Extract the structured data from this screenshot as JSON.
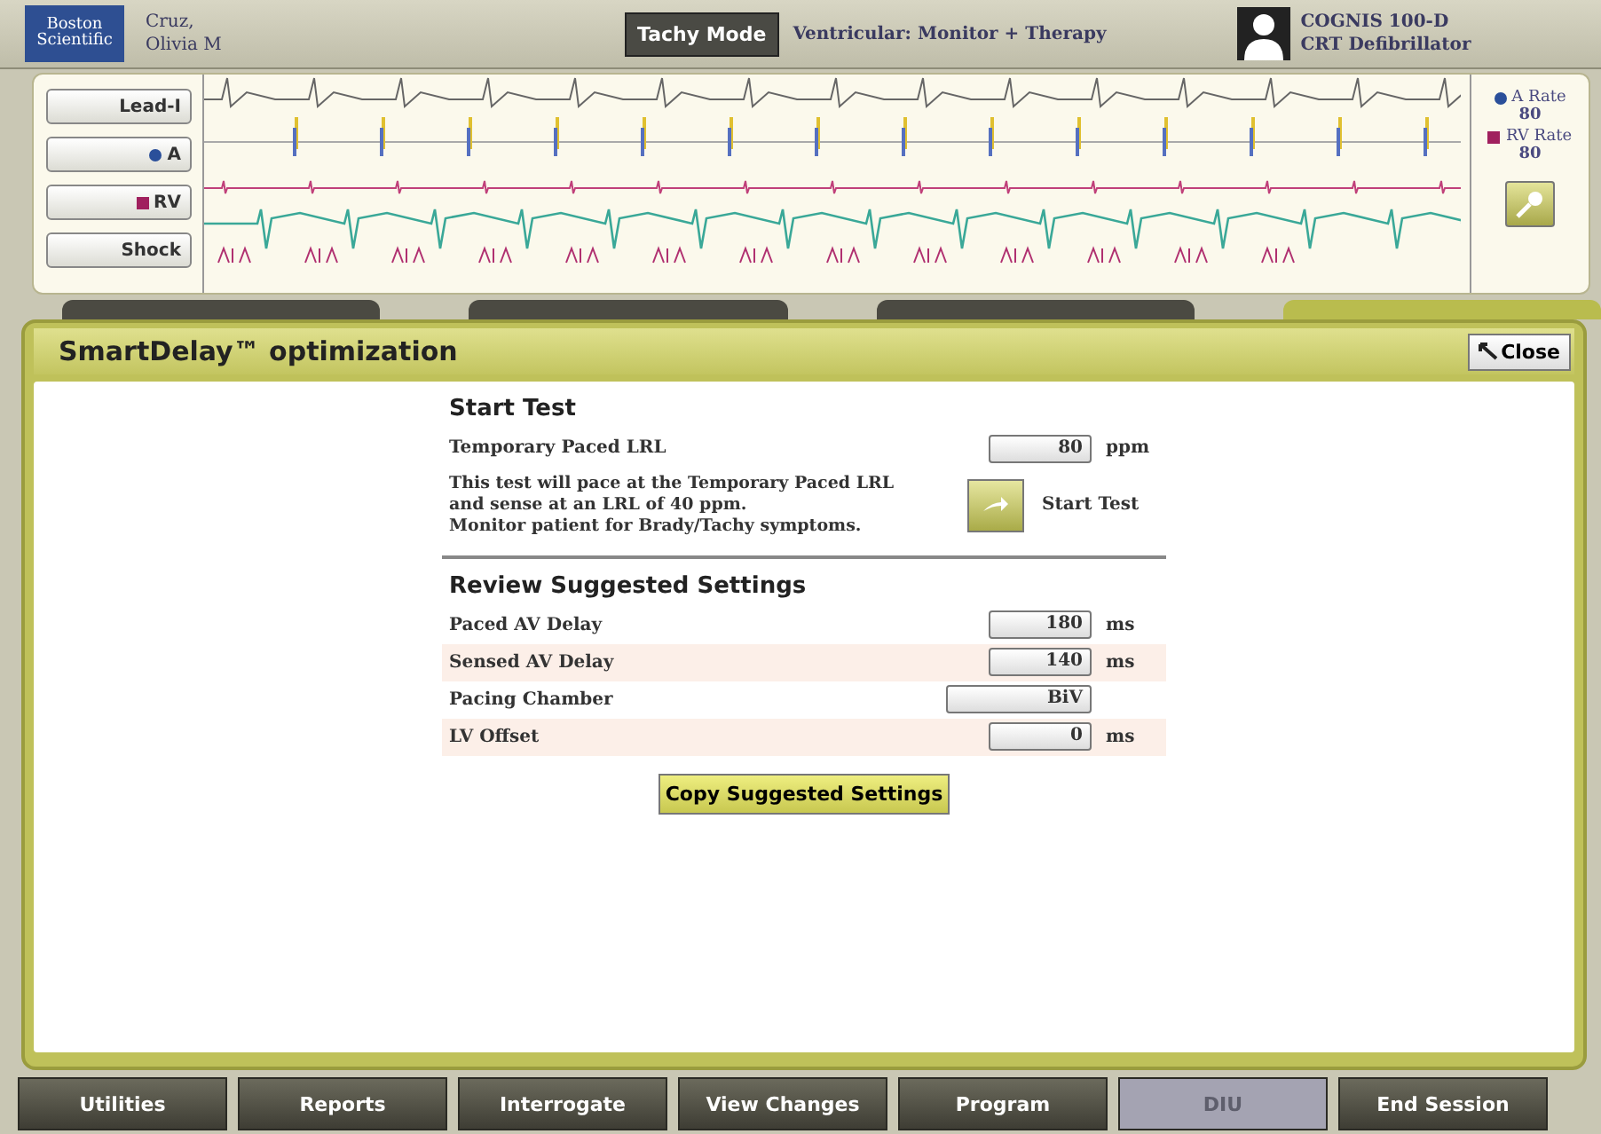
{
  "header": {
    "logo": "Boston Scientific",
    "patient": [
      "Cruz,",
      "Olivia M"
    ],
    "mode_button": "Tachy Mode",
    "mode_text": "Ventricular: Monitor + Therapy",
    "device": [
      "COGNIS 100-D",
      "CRT Defibrillator"
    ]
  },
  "ecg": {
    "channel_buttons": [
      {
        "label": "Lead-I"
      },
      {
        "label": "A",
        "kind": "dot",
        "color": "#2a4f9a"
      },
      {
        "label": "RV",
        "kind": "square",
        "color": "#a0205e"
      },
      {
        "label": "Shock"
      }
    ],
    "rates": [
      {
        "label": "A Rate",
        "value": "80",
        "kind": "dot",
        "color": "#2a4f9a"
      },
      {
        "label": "RV Rate",
        "value": "80",
        "kind": "square",
        "color": "#a0205e"
      }
    ]
  },
  "tabs": [
    {
      "selected": false
    },
    {
      "selected": false
    },
    {
      "selected": false
    },
    {
      "selected": true
    }
  ],
  "panel": {
    "title": "SmartDelay™ optimization",
    "close": "Close",
    "start_test": {
      "heading": "Start Test",
      "field_label": "Temporary Paced LRL",
      "value": "80",
      "unit": "ppm",
      "note": [
        "This test will pace at the Temporary Paced LRL",
        "and sense at an LRL of 40 ppm.",
        "Monitor patient for Brady/Tachy symptoms."
      ],
      "button": "Start Test"
    },
    "review": {
      "heading": "Review Suggested Settings",
      "rows": [
        {
          "label": "Paced AV Delay",
          "value": "180",
          "unit": "ms"
        },
        {
          "label": "Sensed AV Delay",
          "value": "140",
          "unit": "ms"
        },
        {
          "label": "Pacing Chamber",
          "value": "BiV"
        },
        {
          "label": "LV Offset",
          "value": "0",
          "unit": "ms"
        }
      ],
      "copy_button": "Copy Suggested Settings"
    }
  },
  "footer": [
    {
      "label": "Utilities",
      "disabled": false
    },
    {
      "label": "Reports",
      "disabled": false
    },
    {
      "label": "Interrogate",
      "disabled": false
    },
    {
      "label": "View Changes",
      "disabled": false
    },
    {
      "label": "Program",
      "disabled": false
    },
    {
      "label": "DIU",
      "disabled": true
    },
    {
      "label": "End Session",
      "disabled": false
    }
  ]
}
